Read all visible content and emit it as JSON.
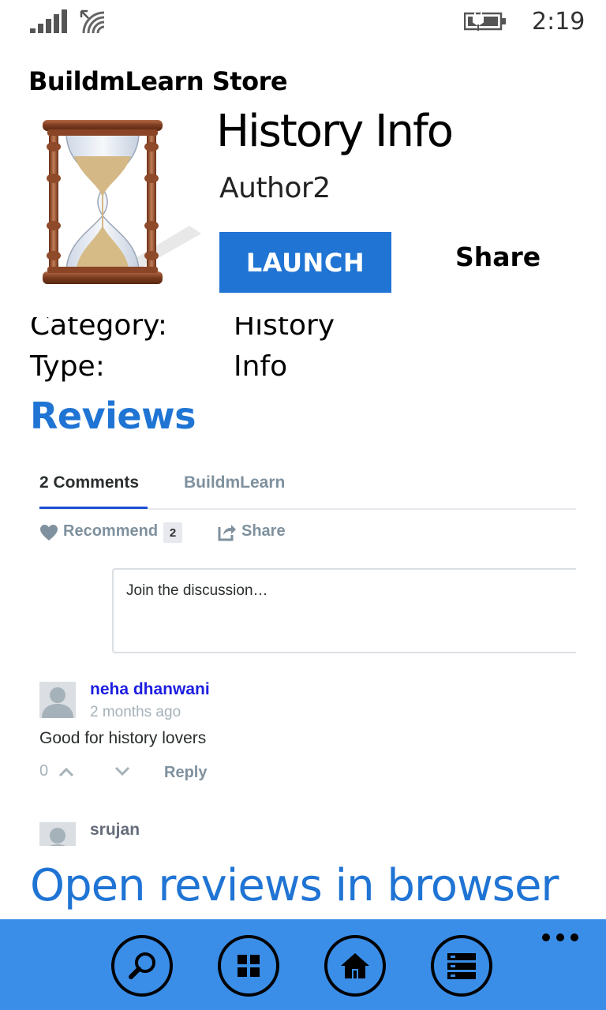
{
  "status_bar": {
    "time": "2:19",
    "icons": [
      "signal-icon",
      "wifi-icon",
      "battery-icon"
    ]
  },
  "app": {
    "title": "BuildmLearn Store"
  },
  "detail": {
    "name": "History Info",
    "author": "Author2",
    "launch_label": "LAUNCH",
    "share_label": "Share",
    "icon": "hourglass-icon",
    "fields": [
      {
        "label": "Category:",
        "value": "History"
      },
      {
        "label": "Type:",
        "value": "Info"
      }
    ]
  },
  "reviews": {
    "heading": "Reviews",
    "tabs": [
      {
        "label": "2 Comments",
        "active": true
      },
      {
        "label": "BuildmLearn",
        "active": false
      }
    ],
    "recommend_label": "Recommend",
    "recommend_count": "2",
    "share_label": "Share",
    "compose_placeholder": "Join the discussion…",
    "comments": [
      {
        "author": "neha dhanwani",
        "time": "2 months ago",
        "text": "Good for history lovers",
        "votes": "0",
        "reply_label": "Reply"
      },
      {
        "author": "srujan"
      }
    ],
    "open_browser_label": "Open reviews in browser"
  },
  "app_bar": {
    "buttons": [
      "search-icon",
      "apps-grid-icon",
      "home-icon",
      "list-icon"
    ],
    "more_icon": "more-dots-icon"
  },
  "colors": {
    "accent": "#1f74d4",
    "app_bar": "#3a8ee8",
    "disqus_link": "#1d1ee0",
    "muted": "#7f919e"
  }
}
